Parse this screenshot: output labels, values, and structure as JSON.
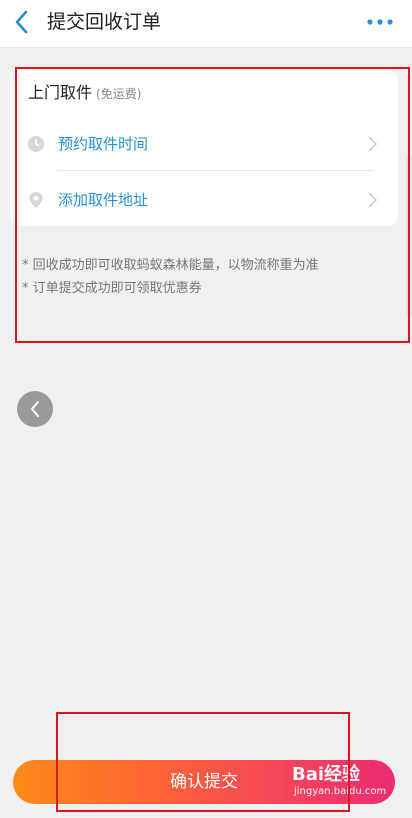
{
  "header": {
    "title": "提交回收订单",
    "back_icon": "chevron-left-icon",
    "more_icon": "more-dots-icon",
    "accent_color": "#2a8fcf"
  },
  "pickup": {
    "title": "上门取件",
    "subtitle": "(免运费)",
    "items": [
      {
        "label": "预约取件时间",
        "icon": "clock-icon"
      },
      {
        "label": "添加取件地址",
        "icon": "location-pin-icon"
      }
    ]
  },
  "notes": [
    "* 回收成功即可收取蚂蚁森林能量，以物流称重为准",
    "* 订单提交成功即可领取优惠券"
  ],
  "footer": {
    "submit_label": "确认提交",
    "button_gradient": [
      "#ff8a1a",
      "#ec2c72"
    ]
  },
  "watermark": {
    "brand": "Bai经验",
    "url": "jingyan.baidu.com"
  },
  "annotation_color": "#e0141a"
}
